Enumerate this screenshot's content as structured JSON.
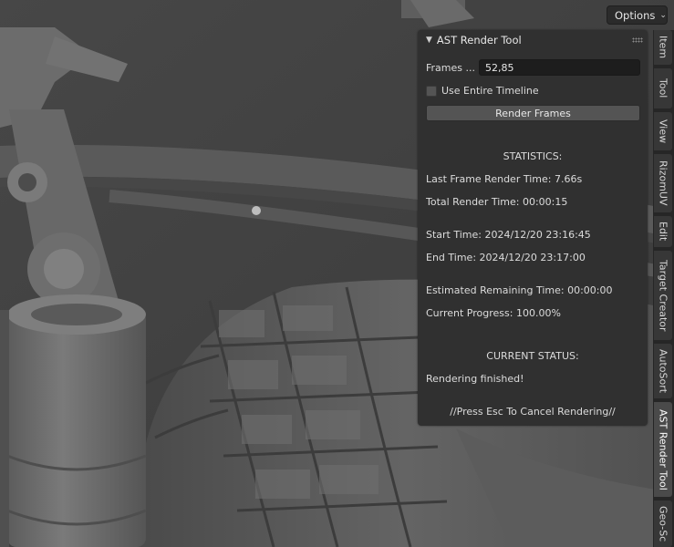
{
  "header": {
    "options_label": "Options",
    "options_icon": "chevron-down-icon"
  },
  "panel": {
    "title": "AST Render Tool",
    "collapse_icon": "triangle-down-icon",
    "frames_label": "Frames ...",
    "frames_value": "52,85",
    "use_entire_timeline_label": "Use Entire Timeline",
    "use_entire_timeline_checked": false,
    "render_button_label": "Render Frames",
    "statistics_heading": "STATISTICS:",
    "last_frame_render_time": "Last Frame Render Time: 7.66s",
    "total_render_time": "Total Render Time: 00:00:15",
    "start_time": "Start Time: 2024/12/20 23:16:45",
    "end_time": "End Time: 2024/12/20 23:17:00",
    "estimated_remaining_time": "Estimated Remaining Time: 00:00:00",
    "current_progress": "Current Progress: 100.00%",
    "current_status_heading": "CURRENT STATUS:",
    "status_text": "Rendering finished!",
    "cancel_hint": "//Press Esc To Cancel Rendering//"
  },
  "sidebar_tabs": [
    {
      "label": "Item",
      "active": false
    },
    {
      "label": "Tool",
      "active": false
    },
    {
      "label": "View",
      "active": false
    },
    {
      "label": "RizomUV",
      "active": false
    },
    {
      "label": "Edit",
      "active": false
    },
    {
      "label": "Target Creator",
      "active": false
    },
    {
      "label": "AutoSort",
      "active": false
    },
    {
      "label": "AST Render Tool",
      "active": true
    },
    {
      "label": "Geo-Sc",
      "active": false
    }
  ],
  "colors": {
    "panel_bg": "#303030",
    "viewport_bg": "#3d3d3d",
    "field_bg": "#1d1d1d",
    "button_bg": "#545454"
  }
}
